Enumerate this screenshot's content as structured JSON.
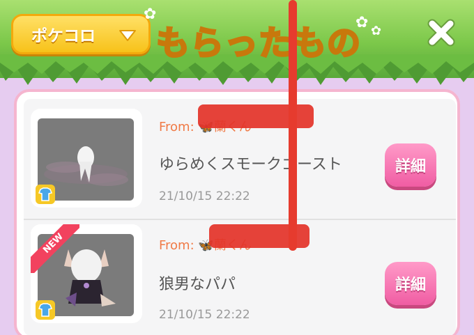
{
  "header": {
    "dropdown_label": "ポケコロ",
    "title": "もらったもの"
  },
  "items": [
    {
      "from_prefix": "From: ",
      "sender": "蘭くん",
      "item_name": "ゆらめくスモークゴースト",
      "date": "21/10/15 22:22",
      "detail_label": "詳細",
      "is_new": false
    },
    {
      "from_prefix": "From: ",
      "sender": "蘭くん",
      "item_name": "狼男なパパ",
      "date": "21/10/15 22:22",
      "detail_label": "詳細",
      "is_new": true,
      "new_label": "NEW"
    }
  ],
  "colors": {
    "header_green": "#7cc84a",
    "dropdown_yellow": "#f7c21a",
    "title_gold": "#ffd84a",
    "panel_border_pink": "#f5b5cf",
    "from_orange": "#f07a46",
    "detail_pink": "#f05da3",
    "background_lavender": "#e6ccf0",
    "redaction_red": "#e3342a"
  },
  "icons": [
    "chevron-down-icon",
    "close-icon",
    "outfit-icon",
    "butterfly-icon"
  ]
}
